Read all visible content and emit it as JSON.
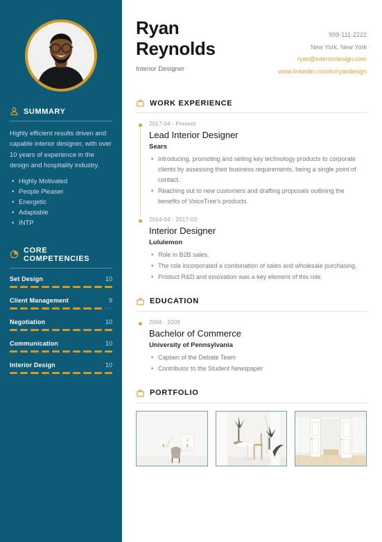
{
  "colors": {
    "sidebar_bg": "#0D5B76",
    "accent_gold": "#D19A2A",
    "link_gold": "#E0A43C",
    "text_dark": "#16161A",
    "text_muted": "#77777D",
    "thumb_border": "#6F9FB2"
  },
  "header": {
    "first_name": "Ryan",
    "last_name": "Reynolds",
    "role": "Interior Designer",
    "contact": [
      {
        "text": "999-111-2222",
        "is_link": false
      },
      {
        "text": "New York, New York",
        "is_link": false
      },
      {
        "text": "ryan@interiordesign.com",
        "is_link": true
      },
      {
        "text": "www.linkedin.com/in/ryandesign",
        "is_link": true
      }
    ]
  },
  "sidebar": {
    "avatar_alt": "profile-photo",
    "summary": {
      "icon": "person-icon",
      "title": "SUMMARY",
      "paragraph": "Highly efficient results driven and capable interior designer, with over 10 years of experience in the design and hospitality industry.",
      "bullets": [
        "Highly Motivated",
        "People Pleaser",
        "Energetic",
        "Adaptable",
        "INTP"
      ]
    },
    "competencies": {
      "icon": "pie-chart-icon",
      "title": "CORE COMPETENCIES",
      "max_score": 10,
      "segments": 10,
      "items": [
        {
          "name": "Set Design",
          "score": 10
        },
        {
          "name": "Client Management",
          "score": 9
        },
        {
          "name": "Negotiation",
          "score": 10
        },
        {
          "name": "Communication",
          "score": 10
        },
        {
          "name": "Interior Design",
          "score": 10
        }
      ]
    }
  },
  "main": {
    "work_experience": {
      "icon": "briefcase-icon",
      "title": "WORK EXPERIENCE",
      "entries": [
        {
          "date": "2017-04 - Present",
          "title": "Lead Interior Designer",
          "org": "Sears",
          "points": [
            "Introducing, promoting and selling key technology products to corporate clients by assessing their business requirements, being a single point of contact.",
            "Reaching out to new customers and drafting proposals outlining the benefits of VoiceTree's products."
          ]
        },
        {
          "date": "2014-04 - 2017-03",
          "title": "Interior Designer",
          "org": "Lululemon",
          "points": [
            "Role in B2B sales.",
            "The role incorporated a combination of sales and wholesale purchasing.",
            "Product R&D and innovation was a key element of this role."
          ]
        }
      ]
    },
    "education": {
      "icon": "briefcase-icon",
      "title": "EDUCATION",
      "entries": [
        {
          "date": "2006 - 2009",
          "title": "Bachelor of Commerce",
          "org": "University of Pennsylvania",
          "points": [
            "Captain of the Debate Team",
            "Contributor to the Student Newspaper"
          ]
        }
      ]
    },
    "portfolio": {
      "icon": "briefcase-icon",
      "title": "PORTFOLIO",
      "thumbnails": [
        {
          "alt": "white-desk-with-chair-interior"
        },
        {
          "alt": "dining-table-with-plants-interior"
        },
        {
          "alt": "white-double-doors-empty-room"
        }
      ]
    }
  }
}
